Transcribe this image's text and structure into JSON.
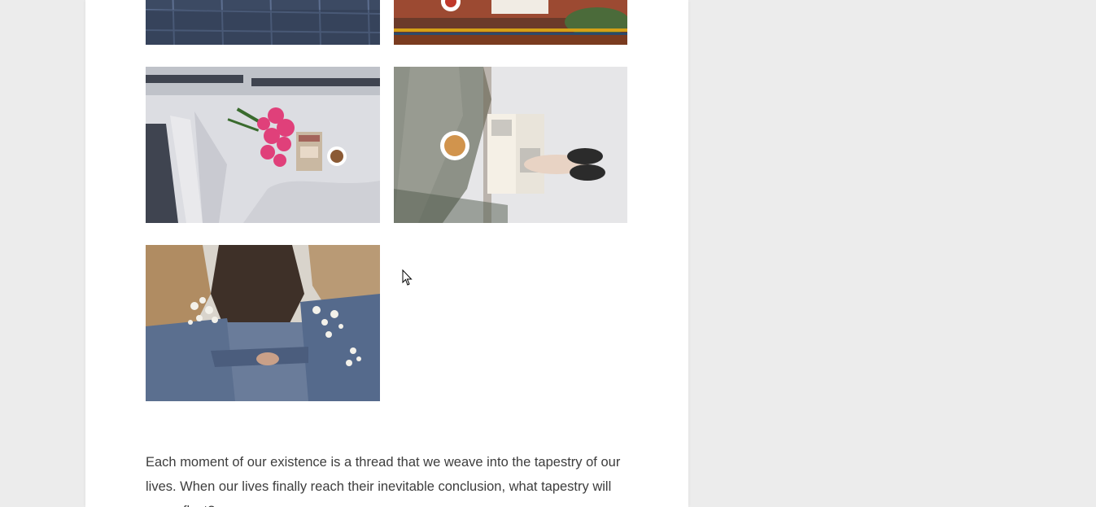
{
  "gallery": {
    "images": [
      {
        "subject": "dark plaid bed sheet"
      },
      {
        "subject": "person reading a book with coffee on a striped rug"
      },
      {
        "subject": "pink flowers, book and coffee on white bed sheets"
      },
      {
        "subject": "person in grey sweater reading with coffee on bed"
      },
      {
        "subject": "three friends in denim jackets with baby's breath flowers"
      }
    ]
  },
  "post": {
    "paragraph": "Each moment of our existence is a thread that we weave into the tapestry of our lives. When our lives finally reach their inevitable conclusion, what tapestry will you reflect?"
  },
  "colors": {
    "background": "#ececec",
    "card": "#ffffff",
    "text": "#3d3d3d"
  }
}
